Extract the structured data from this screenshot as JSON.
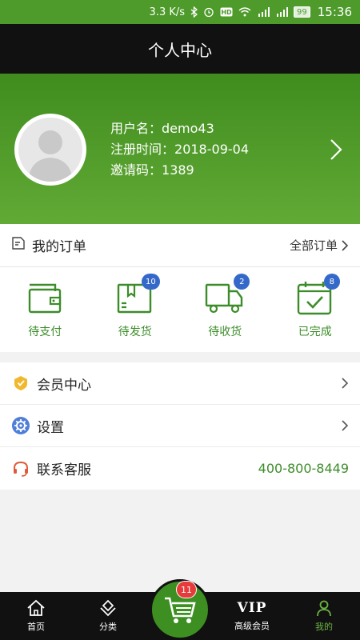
{
  "status_bar": {
    "speed": "3.3 K/s",
    "battery": "99",
    "time": "15:36"
  },
  "header": {
    "title": "个人中心"
  },
  "profile": {
    "username_label": "用户名：",
    "username": "demo43",
    "register_label": "注册时间：",
    "register_date": "2018-09-04",
    "invite_label": "邀请码：",
    "invite_code": "1389"
  },
  "orders": {
    "title": "我的订单",
    "all_label": "全部订单",
    "items": [
      {
        "label": "待支付",
        "badge": ""
      },
      {
        "label": "待发货",
        "badge": "10"
      },
      {
        "label": "待收货",
        "badge": "2"
      },
      {
        "label": "已完成",
        "badge": "8"
      }
    ]
  },
  "menu": {
    "vip_center": "会员中心",
    "settings": "设置",
    "contact": "联系客服",
    "phone": "400-800-8449"
  },
  "bottom_nav": {
    "home": "首页",
    "category": "分类",
    "cart_badge": "11",
    "vip_icon_text": "VIP",
    "vip": "高级会员",
    "mine": "我的"
  },
  "colors": {
    "accent": "#3d8c2a",
    "badge_blue": "#3569c9",
    "badge_red": "#e73b3b",
    "dark": "#111111"
  }
}
